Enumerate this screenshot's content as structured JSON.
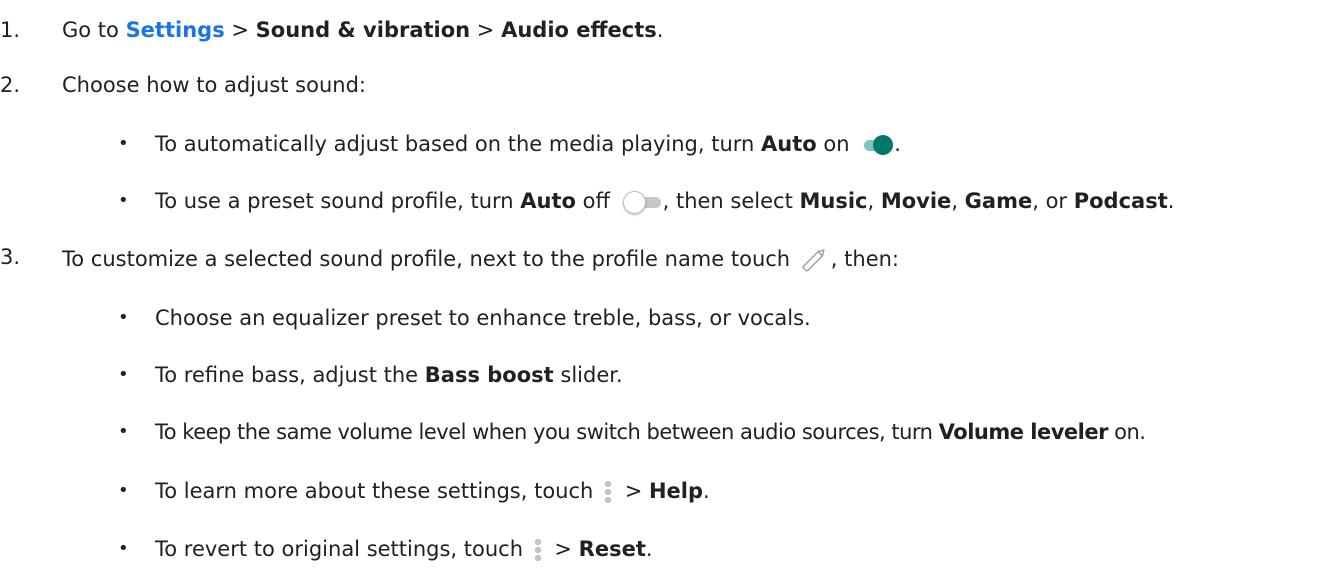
{
  "step1": {
    "num": "1.",
    "go_to": "Go to ",
    "settings_link": "Settings",
    "sep1": " > ",
    "sound_vibration": "Sound & vibration",
    "sep2": " > ",
    "audio_effects": "Audio effects",
    "period": "."
  },
  "step2": {
    "num": "2.",
    "text": "Choose how to adjust sound:",
    "bullet1": {
      "pre": "To automatically adjust based on the media playing, turn ",
      "auto": "Auto",
      "on": " on ",
      "period": "."
    },
    "bullet2": {
      "pre": "To use a preset sound profile, turn ",
      "auto": "Auto",
      "off": " off ",
      "then": ", then select ",
      "music": "Music",
      "comma1": ", ",
      "movie": "Movie",
      "comma2": ", ",
      "game": "Game",
      "or": ", or ",
      "podcast": "Podcast",
      "period": "."
    }
  },
  "step3": {
    "num": "3.",
    "pre": "To customize a selected sound profile, next to the profile name touch ",
    "post": ", then:",
    "bullet1": "Choose an equalizer preset to enhance treble, bass, or vocals.",
    "bullet2": {
      "pre": "To refine bass, adjust the ",
      "bass_boost": "Bass boost",
      "post": " slider."
    },
    "bullet3": {
      "pre": "To keep the same volume level when you switch between audio sources, turn ",
      "volume_leveler": "Volume leveler",
      "post": " on."
    },
    "bullet4": {
      "pre": "To learn more about these settings, touch ",
      "sep": " > ",
      "help": "Help",
      "period": "."
    },
    "bullet5": {
      "pre": "To revert to original settings, touch ",
      "sep": " > ",
      "reset": "Reset",
      "period": "."
    }
  },
  "bullet_char": "•",
  "icons": {
    "toggle_on": "toggle-on-icon",
    "toggle_off": "toggle-off-icon",
    "edit": "pencil-icon",
    "more": "more-vert-icon"
  },
  "colors": {
    "link": "#1a73e8",
    "toggle_on_thumb": "#00796b",
    "toggle_on_track": "#7fc4bd",
    "text": "#202124"
  }
}
